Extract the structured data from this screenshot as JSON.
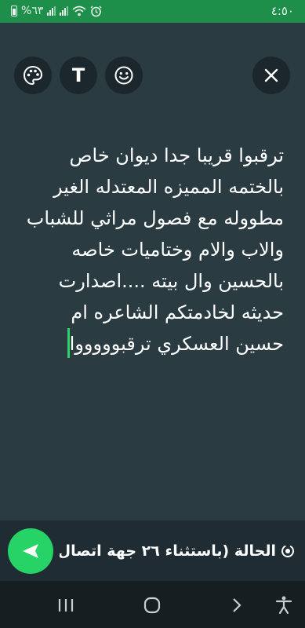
{
  "status_bar": {
    "time": "٤:٥٠",
    "battery_percent": "%٦٣",
    "icons": [
      "battery-icon",
      "signal-icon",
      "signal-icon",
      "wifi-icon",
      "alarm-icon"
    ],
    "background": "#1e8f4a"
  },
  "toolbar": {
    "buttons": [
      "palette-icon",
      "text-format-icon",
      "emoji-icon"
    ],
    "text_tool_label": "T",
    "close_icon": "close-icon"
  },
  "editor": {
    "background": "#2a3b42",
    "text": "ترقبوا قريبا جدا ديوان خاص بالختمه المميزه المعتدله الغير مطووله مع فصول مراثي للشباب والاب والام وختاميات خاصه بالحسين وال بيته ....اصدارت حديثه لخادمتكم الشاعره ام حسين العسكري ترقبوووووا"
  },
  "footer": {
    "recipient_text": "الحالة (باستثناء ٢٦ جهة اتصال)",
    "recipient_icon": "status-icon",
    "send_icon": "send-icon",
    "accent": "#25d366"
  },
  "nav_bar": {
    "buttons": [
      "recent-apps-icon",
      "home-icon",
      "back-icon",
      "accessibility-icon"
    ]
  }
}
